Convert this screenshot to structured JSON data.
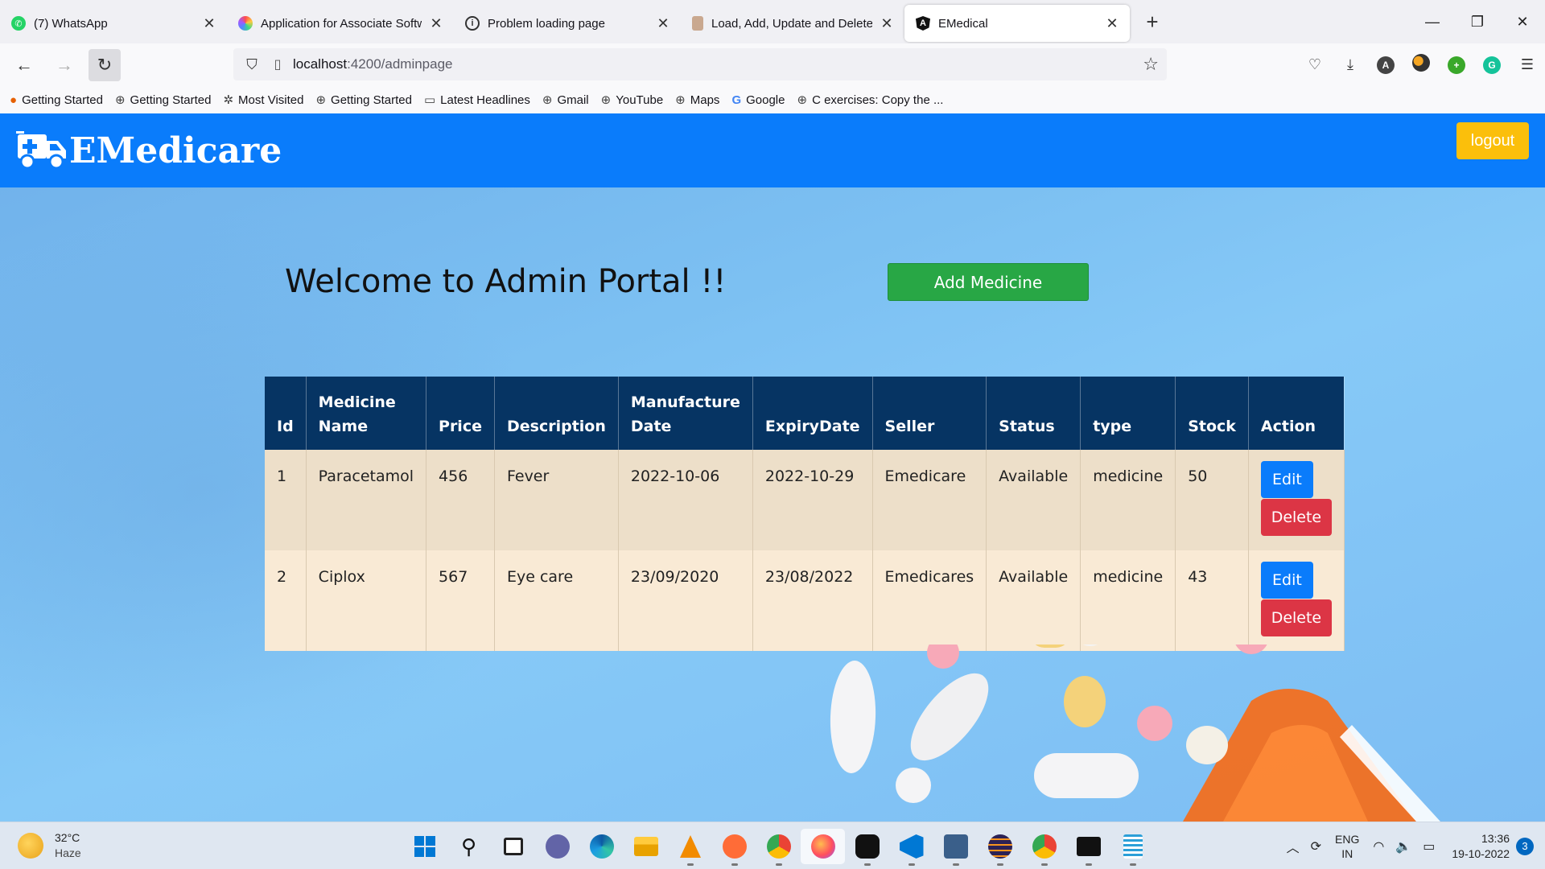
{
  "browser": {
    "tabs": [
      {
        "title": "(7) WhatsApp",
        "icon": "whatsapp-icon",
        "color": "#25d366",
        "active": false
      },
      {
        "title": "Application for Associate Software",
        "icon": "app-logo-icon",
        "color": "#a259ff",
        "active": false
      },
      {
        "title": "Problem loading page",
        "icon": "info-icon",
        "color": "#333333",
        "active": false
      },
      {
        "title": "Load, Add, Update and Delete T",
        "icon": "site-icon",
        "color": "#9b6b4a",
        "active": false
      },
      {
        "title": "EMedical",
        "icon": "angular-icon",
        "color": "#111111",
        "active": true
      }
    ],
    "url_host": "localhost",
    "url_path": ":4200/adminpage",
    "bookmarks": [
      {
        "label": "Getting Started",
        "icon": "firefox-icon"
      },
      {
        "label": "Getting Started",
        "icon": "globe-icon"
      },
      {
        "label": "Most Visited",
        "icon": "gear-icon"
      },
      {
        "label": "Getting Started",
        "icon": "globe-icon"
      },
      {
        "label": "Latest Headlines",
        "icon": "folder-icon"
      },
      {
        "label": "Gmail",
        "icon": "globe-icon"
      },
      {
        "label": "YouTube",
        "icon": "globe-icon"
      },
      {
        "label": "Maps",
        "icon": "globe-icon"
      },
      {
        "label": "Google",
        "icon": "google-icon"
      },
      {
        "label": "C exercises: Copy the ...",
        "icon": "globe-icon"
      }
    ]
  },
  "app": {
    "brand": "EMedicare",
    "logout_label": "logout",
    "welcome": "Welcome to Admin Portal !!",
    "add_label": "Add Medicine",
    "colors": {
      "navbar": "#0a7cfb",
      "logout": "#fbbf0b",
      "add": "#28a745",
      "header": "#063463",
      "edit": "#0a7cfb",
      "delete": "#dc3545"
    }
  },
  "table": {
    "headers": [
      "Id",
      "Medicine Name",
      "Price",
      "Description",
      "Manufacture Date",
      "ExpiryDate",
      "Seller",
      "Status",
      "type",
      "Stock",
      "Action"
    ],
    "edit_label": "Edit",
    "delete_label": "Delete",
    "rows": [
      [
        "1",
        "Paracetamol",
        "456",
        "Fever",
        "2022-10-06",
        "2022-10-29",
        "Emedicare",
        "Available",
        "medicine",
        "50"
      ],
      [
        "2",
        "Ciplox",
        "567",
        "Eye care",
        "23/09/2020",
        "23/08/2022",
        "Emedicares",
        "Available",
        "medicine",
        "43"
      ]
    ]
  },
  "taskbar": {
    "temperature": "32°C",
    "weather": "Haze",
    "lang_top": "ENG",
    "lang_bottom": "IN",
    "time": "13:36",
    "date": "19-10-2022",
    "notifications": "3"
  }
}
